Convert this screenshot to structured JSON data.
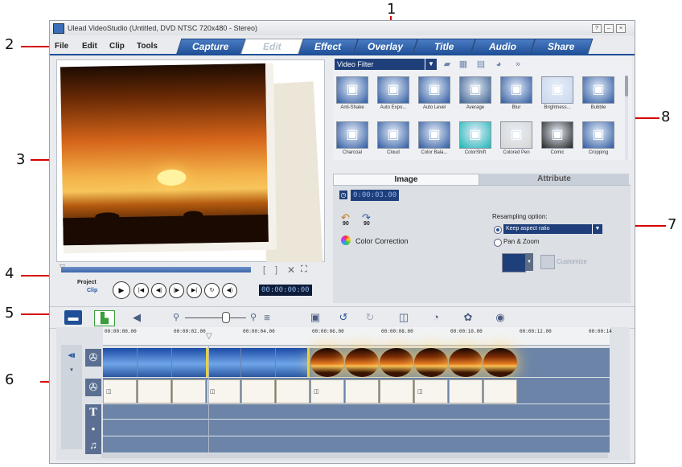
{
  "callouts": [
    "1",
    "2",
    "3",
    "4",
    "5",
    "6",
    "7",
    "8"
  ],
  "window": {
    "title": "Ulead VideoStudio (Untitled, DVD NTSC 720x480 - Stereo)",
    "controls": [
      "?",
      "–",
      "×"
    ]
  },
  "menu": [
    "File",
    "Edit",
    "Clip",
    "Tools"
  ],
  "tabs": [
    "Capture",
    "Edit",
    "Effect",
    "Overlay",
    "Title",
    "Audio",
    "Share"
  ],
  "active_tab": "Edit",
  "player": {
    "project_label": "Project",
    "clip_label": "Clip",
    "timecode": "00:00:00:00",
    "buttons": [
      "play",
      "home",
      "prev-frame",
      "next-frame",
      "end",
      "repeat",
      "volume"
    ],
    "trim_marks": [
      "[",
      "]"
    ]
  },
  "library": {
    "category": "Video Filter",
    "items": [
      "Anti-Shake",
      "Auto Expo...",
      "Auto Level",
      "Average",
      "Blur",
      "Brightness...",
      "Bubble",
      "Charcoal",
      "Cloud",
      "Color Bala...",
      "ColorShift",
      "Colored Pen",
      "Comic",
      "Cropping"
    ]
  },
  "options": {
    "tabs": [
      "Image",
      "Attribute"
    ],
    "duration": "0:00:03.00",
    "rotate_labels": [
      "90",
      "90"
    ],
    "color_correction": "Color Correction",
    "resampling_label": "Resampling option:",
    "keep_aspect": "Keep aspect ratio",
    "pan_zoom": "Pan & Zoom",
    "customize": "Customize"
  },
  "timeline": {
    "ruler": [
      "00:00:00.00",
      "00:00:02.00",
      "00:00:04.00",
      "00:00:06.00",
      "00:00:08.00",
      "00:00:10.00",
      "00:00:12.00",
      "00:00:14"
    ],
    "track_icons": [
      "T",
      "•",
      "♫"
    ]
  }
}
